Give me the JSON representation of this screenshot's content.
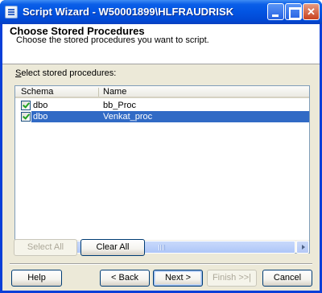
{
  "window": {
    "title": "Script Wizard - W50001899\\HLFRAUDRISK"
  },
  "header": {
    "title": "Choose Stored Procedures",
    "subtitle": "Choose the stored procedures you want to script."
  },
  "list": {
    "label_mnemonic": "S",
    "label_rest": "elect stored procedures:",
    "columns": [
      "Schema",
      "Name"
    ],
    "rows": [
      {
        "checked": true,
        "schema": "dbo",
        "name": "bb_Proc",
        "selected": false
      },
      {
        "checked": true,
        "schema": "dbo",
        "name": "Venkat_proc",
        "selected": true
      }
    ]
  },
  "buttons": {
    "select_all": "Select All",
    "clear_all": "Clear All",
    "help": "Help",
    "back": "< Back",
    "next": "Next >",
    "finish": "Finish >>|",
    "cancel": "Cancel"
  },
  "colors": {
    "selection": "#316ac5",
    "titlebar": "#0254e2",
    "dialog_bg": "#ece9d8"
  }
}
